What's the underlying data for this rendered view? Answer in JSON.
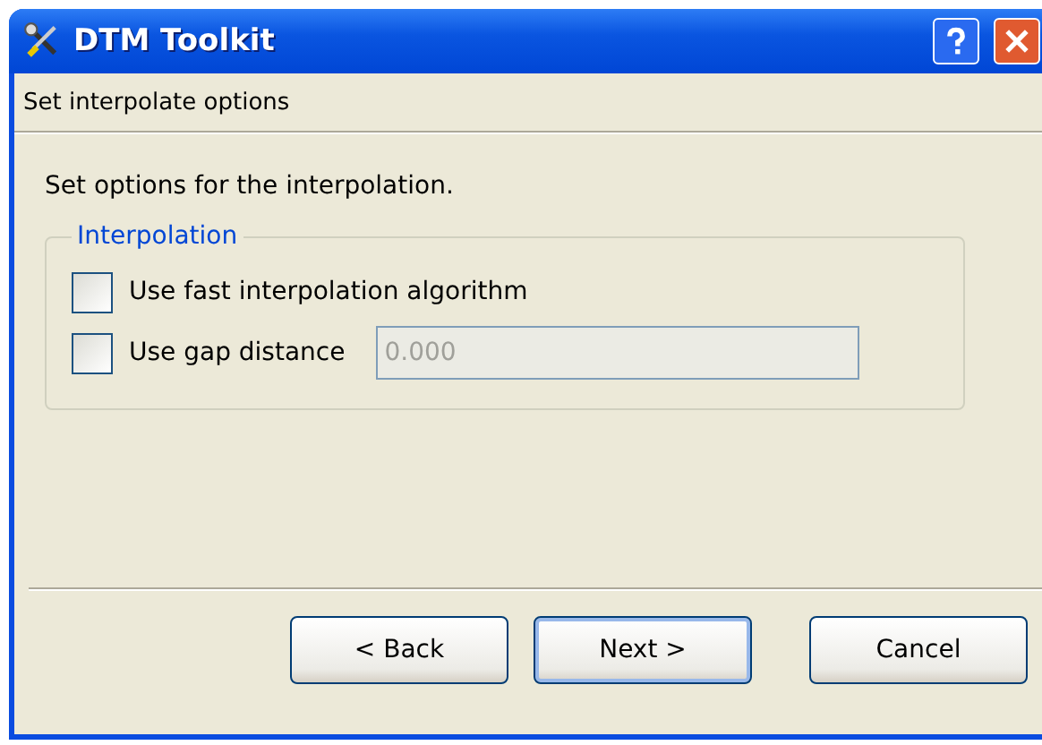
{
  "window": {
    "title": "DTM Toolkit"
  },
  "header": {
    "title": "Set interpolate options"
  },
  "intro": "Set options for the interpolation.",
  "group": {
    "title": "Interpolation",
    "options": [
      {
        "kind": "checkbox",
        "label": "Use fast interpolation algorithm",
        "checked": false
      },
      {
        "kind": "checkbox-field",
        "label": "Use gap distance",
        "checked": false,
        "value": "0.000",
        "disabled": true
      }
    ]
  },
  "buttons": [
    {
      "label": "< Back",
      "default": false
    },
    {
      "label": "Next >",
      "default": true
    },
    {
      "label": "Cancel",
      "default": false
    }
  ]
}
